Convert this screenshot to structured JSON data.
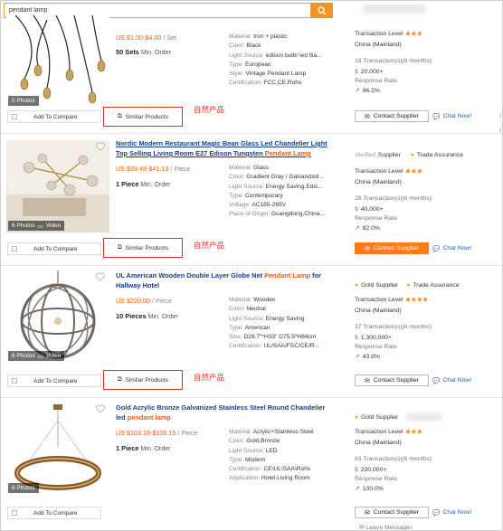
{
  "search": {
    "value": "pendant lamp"
  },
  "products": [
    {
      "photos": "5 Photos",
      "title_text": "",
      "price": "US $1.00-$4.00",
      "price_unit": " / Set",
      "moq_value": "50 Sets",
      "moq_label": " Min. Order",
      "attrs": [
        {
          "k": "Material: ",
          "v": "Iron + plastic"
        },
        {
          "k": "Color: ",
          "v": "Black"
        },
        {
          "k": "Light Source: ",
          "v": "edison bulb/ led fila..."
        },
        {
          "k": "Type: ",
          "v": "European"
        },
        {
          "k": "Style: ",
          "v": "Vintage Pendant Lamp"
        },
        {
          "k": "Certification: ",
          "v": "FCC,CE,Rohs"
        }
      ],
      "supplier": {
        "transaction_level": "Transaction Level",
        "country": "China (Mainland)",
        "transactions": "18 Transaction(s)(6 months)",
        "amount": "20,000+",
        "response_label": "Response Rate",
        "response_rate": "96.2%"
      },
      "compare": "Add To Compare",
      "similar": "Similar Products",
      "natural": "自然产品",
      "contact": "Contact Supplier",
      "chat": "Chat Now!"
    },
    {
      "photos": "6 Photos",
      "video": "Video",
      "title_parts": [
        "Nordic Modern Restaurant Magic Bean Glass Led Chandelier Light Top Selling Living Room E27 Edison Tungsten ",
        "Pendant Lamp"
      ],
      "price": "US $39.48-$41.13",
      "price_unit": " / Piece",
      "moq_value": "1 Piece",
      "moq_label": " Min. Order",
      "attrs": [
        {
          "k": "Material: ",
          "v": "Glass"
        },
        {
          "k": "Color: ",
          "v": "Gradient Gray / Galvanized..."
        },
        {
          "k": "Light Source: ",
          "v": "Energy Saving,Edis..."
        },
        {
          "k": "Type: ",
          "v": "Contemporary"
        },
        {
          "k": "Voltage: ",
          "v": "AC185-265V"
        },
        {
          "k": "Place of Origin: ",
          "v": "Guangdong,China..."
        }
      ],
      "supplier": {
        "verified": "Verified",
        "supplier_label": "Supplier",
        "trade_assurance": "Trade Assurance",
        "transaction_level": "Transaction Level",
        "country": "China (Mainland)",
        "transactions": "28 Transaction(s)(6 months)",
        "amount": "40,000+",
        "response_label": "Response Rate",
        "response_rate": "82.0%"
      },
      "compare": "Add To Compare",
      "similar": "Similar Products",
      "natural": "自然产品",
      "contact": "Contact Supplier",
      "chat": "Chat Now!"
    },
    {
      "photos": "6 Photos",
      "video": "Video",
      "title_parts": [
        "UL American Wooden Double Layer Globe Net ",
        "Pendant Lamp",
        " for Hallway Hotel"
      ],
      "price": "US $220.00",
      "price_unit": " / Piece",
      "moq_value": "10 Pieces",
      "moq_label": " Min. Order",
      "attrs": [
        {
          "k": "Material: ",
          "v": "Wooden"
        },
        {
          "k": "Color: ",
          "v": "Neutral"
        },
        {
          "k": "Light Source: ",
          "v": "Energy Saving"
        },
        {
          "k": "Type: ",
          "v": "American"
        },
        {
          "k": "Size: ",
          "v": "D29.7\"*H33\" D75.5*H84cm"
        },
        {
          "k": "Certification: ",
          "v": "UL/SAA/FSC/CE/R..."
        }
      ],
      "supplier": {
        "supplier_label": "Gold Supplier",
        "trade_assurance": "Trade Assurance",
        "transaction_level": "Transaction Level",
        "country": "China (Mainland)",
        "transactions": "37 Transaction(s)(6 months)",
        "amount": "1,300,000+",
        "response_label": "Response Rate",
        "response_rate": "43.8%"
      },
      "compare": "Add To Compare",
      "similar": "Similar Products",
      "natural": "自然产品",
      "contact": "Contact Supplier",
      "chat": "Chat Now!"
    },
    {
      "photos": "6 Photos",
      "title_parts": [
        "Gold Acrylic Bronze Galvanized Stainless Steel Round Chandelier led ",
        "pendant lamp"
      ],
      "price": "US $103.16-$106.15",
      "price_unit": " / Piece",
      "moq_value": "1 Piece",
      "moq_label": " Min. Order",
      "attrs": [
        {
          "k": "Material: ",
          "v": "Acrylic+Stainless Steel"
        },
        {
          "k": "Color: ",
          "v": "Gold,Bronze"
        },
        {
          "k": "Light Source: ",
          "v": "LED"
        },
        {
          "k": "Type: ",
          "v": "Modern"
        },
        {
          "k": "Certification: ",
          "v": "CE\\UL\\SAA\\Rohs"
        },
        {
          "k": "Application: ",
          "v": "Hotel,Living Room"
        }
      ],
      "supplier": {
        "supplier_label": "Gold Supplier",
        "transaction_level": "Transaction Level",
        "country": "China (Mainland)",
        "transactions": "63 Transaction(s)(6 months)",
        "amount": "230,000+",
        "response_label": "Response Rate",
        "response_rate": "100.0%"
      },
      "compare": "Add To Compare",
      "contact": "Contact Supplier",
      "chat": "Chat Now!",
      "leave_message": "Leave Messages"
    }
  ],
  "colors": {
    "accent": "#f7931e",
    "price": "#e95b10",
    "link": "#1a3c8a",
    "annotation": "#e0302a"
  }
}
